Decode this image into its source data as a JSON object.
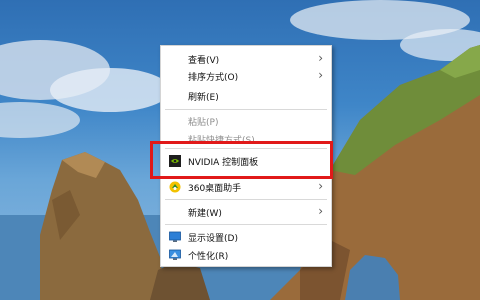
{
  "context_menu": {
    "items": [
      {
        "label": "查看(V)",
        "submenu": true,
        "disabled": false,
        "icon": ""
      },
      {
        "label": "排序方式(O)",
        "submenu": true,
        "disabled": false,
        "icon": ""
      },
      {
        "label": "刷新(E)",
        "submenu": false,
        "disabled": false,
        "icon": ""
      },
      {
        "label": "粘贴(P)",
        "submenu": false,
        "disabled": true,
        "icon": ""
      },
      {
        "label": "粘贴快捷方式(S)",
        "submenu": false,
        "disabled": true,
        "icon": ""
      },
      {
        "label": "NVIDIA 控制面板",
        "submenu": false,
        "disabled": false,
        "icon": "nvidia-icon"
      },
      {
        "label": "360桌面助手",
        "submenu": true,
        "disabled": false,
        "icon": "360-assistant-icon"
      },
      {
        "label": "新建(W)",
        "submenu": true,
        "disabled": false,
        "icon": ""
      },
      {
        "label": "显示设置(D)",
        "submenu": false,
        "disabled": false,
        "icon": "display-settings-icon"
      },
      {
        "label": "个性化(R)",
        "submenu": false,
        "disabled": false,
        "icon": "personalize-icon"
      }
    ],
    "submenu_glyph": "›"
  },
  "highlight": {
    "color": "#e11919"
  }
}
